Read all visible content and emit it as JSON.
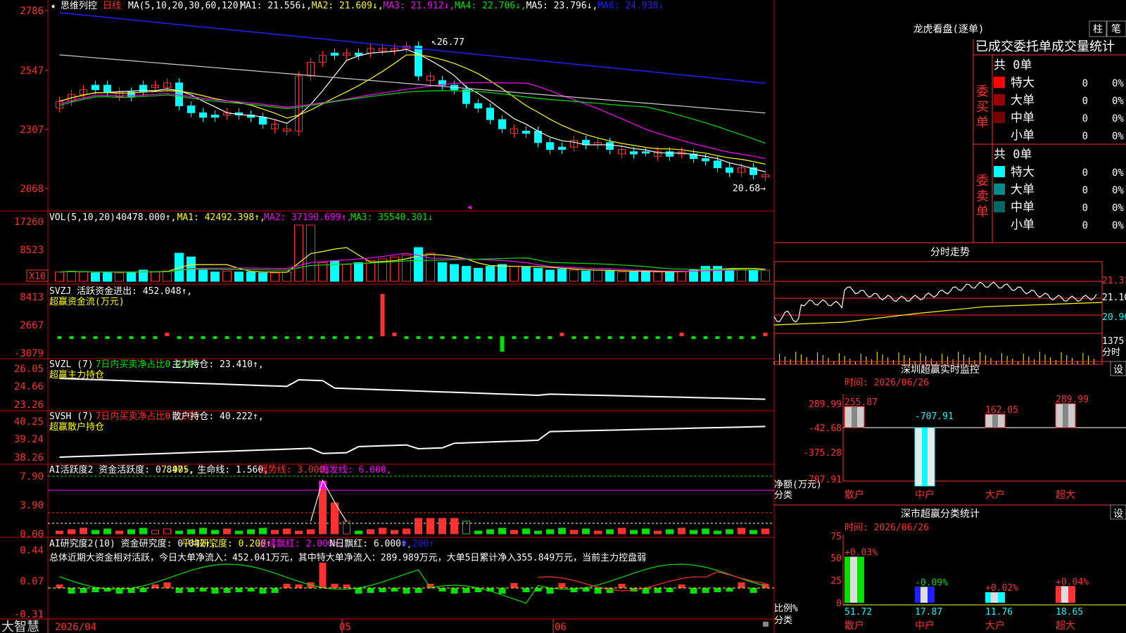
{
  "stock": {
    "star": "★",
    "name": "思维列控",
    "period": "日线"
  },
  "colors": {
    "red": "#ff3030",
    "cyan": "#00ffff",
    "white": "#ffffff",
    "yellow": "#ffff00",
    "magenta": "#ff00ff",
    "green": "#00e000",
    "blue": "#2020ff",
    "grid": "#cc0000",
    "divider": "#cc0000"
  },
  "kline": {
    "yticks": [
      "2786",
      "2547",
      "2307",
      "2068"
    ],
    "ma_header": [
      {
        "text": "MA(5,10,20,30,60,120)",
        "color": "#ffffff"
      },
      {
        "text": "MA1: 21.556↓,",
        "color": "#ffffff"
      },
      {
        "text": "MA2: 21.609↓,",
        "color": "#ffff00"
      },
      {
        "text": "MA3: 21.912↓,",
        "color": "#ff00ff"
      },
      {
        "text": "MA4: 22.706↓,",
        "color": "#00e000"
      },
      {
        "text": "MA5: 23.796↓,",
        "color": "#ffffff"
      },
      {
        "text": "MA6: 24.938↓",
        "color": "#2020ff"
      }
    ],
    "high_label": "26.77",
    "low_label": "20.68→"
  },
  "vol": {
    "yticks": [
      "17260",
      "8523"
    ],
    "unit_label": "X10",
    "header": [
      {
        "text": "VOL(5,10,20)",
        "color": "#ffffff"
      },
      {
        "text": "40478.000↑,",
        "color": "#ffffff"
      },
      {
        "text": "MA1: 42492.398↑,",
        "color": "#ffff00"
      },
      {
        "text": "MA2: 37190.699↑,",
        "color": "#ff00ff"
      },
      {
        "text": "MA3: 35540.301↓",
        "color": "#00e000"
      }
    ]
  },
  "svzj": {
    "yticks": [
      "8413",
      "2667",
      "-3079"
    ],
    "header": [
      {
        "text": "SVZJ  活跃资金进出: 452.048↑,",
        "color": "#ffffff"
      }
    ],
    "subtitle": "超赢资金流(万元)"
  },
  "svzl": {
    "yticks": [
      "26.05",
      "24.66",
      "23.26"
    ],
    "header": [
      {
        "text": "SVZL (7)",
        "color": "#ffffff"
      },
      {
        "text": "7日内买卖净占比0.231%",
        "color": "#00e000"
      },
      {
        "text": "主力持仓: 23.410↑,",
        "color": "#ffffff"
      }
    ],
    "subtitle": "超赢主力持仓"
  },
  "svsh": {
    "yticks": [
      "40.25",
      "39.24",
      "38.26"
    ],
    "header": [
      {
        "text": "SVSH (7)",
        "color": "#ffffff"
      },
      {
        "text": "7日内买卖净占比0.226%",
        "color": "#ff3030"
      },
      {
        "text": "散户持仓: 40.222↑,",
        "color": "#ffffff"
      }
    ],
    "subtitle": "超赢散户持仓"
  },
  "ai_active": {
    "yticks": [
      "7.90",
      "3.90",
      "0.00"
    ],
    "header": [
      {
        "text": "AI活跃度2 资金活跃度: 0.847↑,",
        "color": "#ffffff"
      },
      {
        "text": "7.905,",
        "color": "#ffff00"
      },
      {
        "text": "生命线: 1.560,",
        "color": "#ffffff"
      },
      {
        "text": "强势线: 3.000,",
        "color": "#ff3030"
      },
      {
        "text": "爆发线: 6.000,",
        "color": "#ff00ff"
      }
    ]
  },
  "ai_research": {
    "yticks": [
      "0.44",
      "0.07",
      "-0.31"
    ],
    "header": [
      {
        "text": "AI研究度2(10) 资金研究度: 0.042↑,",
        "color": "#ffffff"
      },
      {
        "text": "平均研究度: 0.200↑,",
        "color": "#ffff00"
      },
      {
        "text": "连续飘红: 2.000↑,",
        "color": "#ff00ff"
      },
      {
        "text": "N日飘红: 6.000↑,",
        "color": "#ffffff"
      },
      {
        "text": "0.200↑",
        "color": "#2020ff"
      }
    ],
    "comment": "总体近期大资金相对活跃，今日大单净流入：452.041万元，其中特大单净流入：289.989万元，大单5日累计净入355.849万元，当前主力控盘弱"
  },
  "xaxis": {
    "labels": [
      "2026/04",
      "05",
      "06"
    ]
  },
  "footer": {
    "brand": "大智慧"
  },
  "right": {
    "dragon_title": "龙虎看盘(逐单)",
    "btn_zhu": "柱",
    "btn_bi": "笔",
    "deal_title": "已成交委托单成交量统计",
    "buy": {
      "label": "委买单",
      "total": "共 0单",
      "rows": [
        {
          "name": "特大",
          "value": "0",
          "pct": "0%",
          "color": "#ff0000"
        },
        {
          "name": "大单",
          "value": "0",
          "pct": "0%",
          "color": "#990000"
        },
        {
          "name": "中单",
          "value": "0",
          "pct": "0%",
          "color": "#770000"
        },
        {
          "name": "小单",
          "value": "0",
          "pct": "0%",
          "color": "#000000"
        }
      ]
    },
    "sell": {
      "label": "委卖单",
      "total": "共 0单",
      "rows": [
        {
          "name": "特大",
          "value": "0",
          "pct": "0%",
          "color": "#00ffff"
        },
        {
          "name": "大单",
          "value": "0",
          "pct": "0%",
          "color": "#008c8c"
        },
        {
          "name": "中单",
          "value": "0",
          "pct": "0%",
          "color": "#006666"
        },
        {
          "name": "小单",
          "value": "0",
          "pct": "0%",
          "color": "#000000"
        }
      ]
    },
    "intraday": {
      "title": "分时走势",
      "yticks": [
        "21.31",
        "21.10",
        "20.90"
      ],
      "vol_tick": "1375",
      "unit": "分时"
    },
    "monitor": {
      "title": "深圳超赢实时监控",
      "set_btn": "设",
      "time": "时间: 2026/06/26",
      "yticks": [
        "289.99",
        "-42.68",
        "-375.28",
        "-707.91"
      ],
      "ylabel": "净额(万元)",
      "xlabel": "分类",
      "cats": [
        "散户",
        "中户",
        "大户",
        "超大"
      ],
      "values": [
        255.87,
        -707.91,
        162.05,
        289.99
      ],
      "value_labels": [
        "255.87",
        "-707.91",
        "162.05",
        "289.99"
      ]
    },
    "stat": {
      "title": "深市超赢分类统计",
      "set_btn": "设",
      "time": "时间: 2026/06/26",
      "yticks": [
        "75",
        "50",
        "25",
        "0"
      ],
      "ylabel": "比例%",
      "xlabel": "分类",
      "cats": [
        "散户",
        "中户",
        "大户",
        "超大"
      ],
      "values": [
        51.72,
        17.87,
        11.76,
        18.65
      ],
      "value_labels": [
        "51.72",
        "17.87",
        "11.76",
        "18.65"
      ],
      "change_labels": [
        "+0.03%",
        "-0.09%",
        "+0.02%",
        "+0.04%"
      ]
    }
  }
}
